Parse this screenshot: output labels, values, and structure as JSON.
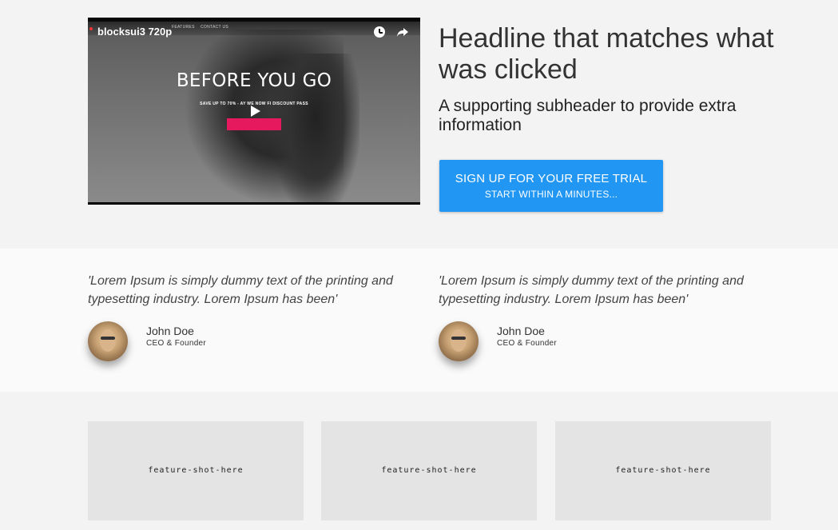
{
  "video": {
    "title": "blocksui3 720p",
    "headline": "BEFORE YOU GO",
    "subline": "SAVE UP TO 70% - AY WE     NOW   FI    DISCOUNT PASS",
    "menu": [
      "FEATURES",
      "CONTACT US"
    ],
    "icons": [
      "watch-later-icon",
      "share-icon",
      "play-icon"
    ]
  },
  "hero": {
    "headline": "Headline that matches what was clicked",
    "subheader": "A supporting subheader to provide extra information",
    "cta_main": "SIGN UP FOR YOUR FREE TRIAL",
    "cta_sub": "START WITHIN A MINUTES...",
    "cta_color": "#2196f3"
  },
  "testimonials": [
    {
      "quote": "'Lorem Ipsum is simply dummy text of the printing and typesetting industry. Lorem Ipsum has been'",
      "name": "John Doe",
      "role": "CEO & Founder"
    },
    {
      "quote": "'Lorem Ipsum is simply dummy text of the printing and typesetting industry. Lorem Ipsum has been'",
      "name": "John Doe",
      "role": "CEO & Founder"
    }
  ],
  "features": [
    {
      "label": "feature-shot-here"
    },
    {
      "label": "feature-shot-here"
    },
    {
      "label": "feature-shot-here"
    }
  ]
}
